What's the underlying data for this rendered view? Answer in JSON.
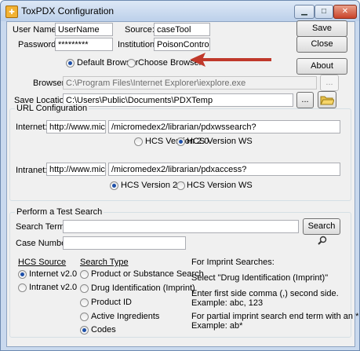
{
  "window": {
    "title": "ToxPDX Configuration"
  },
  "credentials": {
    "username_label": "User Name:",
    "username_value": "UserName",
    "password_label": "Password:",
    "password_value": "*********",
    "source_label": "Source:",
    "source_value": "caseTool",
    "institution_label": "Institution:",
    "institution_value": "PoisonControl"
  },
  "buttons": {
    "save": "Save",
    "close": "Close",
    "about": "About",
    "browse": "...",
    "search": "Search"
  },
  "browser_choice": {
    "default_label": "Default Browser",
    "choose_label": "Choose Browser",
    "selected": "default"
  },
  "browser": {
    "label": "Browser:",
    "value": "C:\\Program Files\\Internet Explorer\\iexplore.exe"
  },
  "save_location": {
    "label": "Save Location:",
    "value": "C:\\Users\\Public\\Documents\\PDXTemp"
  },
  "url_config": {
    "title": "URL Configuration",
    "internet_label": "Internet:",
    "internet_host": "http://www.micromede",
    "internet_path": "/micromedex2/librarian/pdxwssearch?",
    "internet_hcs20": "HCS Version 2.0",
    "internet_hcsws": "HCS Version WS",
    "internet_selected": "ws",
    "intranet_label": "Intranet:",
    "intranet_host": "http://www.micromede",
    "intranet_path": "/micromedex2/librarian/pdxaccess?",
    "intranet_hcs20": "HCS Version 2.0",
    "intranet_hcsws": "HCS Version WS",
    "intranet_selected": "2.0"
  },
  "test_search": {
    "title": "Perform a Test Search",
    "search_term_label": "Search Term:",
    "search_term_value": "",
    "case_number_label": "Case Number:",
    "case_number_value": "",
    "hcs_source_title": "HCS Source",
    "hcs_sources": [
      "Internet v2.0",
      "Intranet v2.0"
    ],
    "hcs_source_selected": 0,
    "search_type_title": "Search Type",
    "search_types": [
      "Product or Substance Search",
      "Drug Identification (Imprint)",
      "Product ID",
      "Active Ingredients",
      "Codes"
    ],
    "search_type_selected": 4,
    "imprint_help": {
      "line1": "For Imprint Searches:",
      "line2": "Select \"Drug Identification (Imprint)\"",
      "line3": "Enter first side comma (,) second side.",
      "line4": "Example: abc, 123",
      "line5": "For partial imprint search end term with an *",
      "line6": "Example: ab*"
    }
  },
  "colors": {
    "arrow": "#c0392b",
    "radio_selected": "#1d4fa8",
    "window_frame": "#c9d9ee"
  },
  "icons": {
    "app": "toxpdx-app-icon",
    "folder": "folder-icon",
    "search": "magnifier-icon",
    "annotation": "red-arrow-icon"
  }
}
